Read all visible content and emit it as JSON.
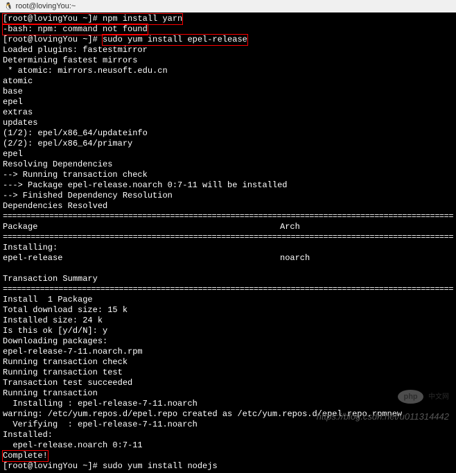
{
  "titlebar": {
    "title": "root@lovingYou:~"
  },
  "terminal": {
    "prompt1": "[root@lovingYou ~]# ",
    "cmd1": "npm install yarn",
    "error1": "-bash: npm: command not found",
    "prompt2": "[root@lovingYou ~]# ",
    "cmd2": "sudo yum install epel-release",
    "lines": [
      "Loaded plugins: fastestmirror",
      "Determining fastest mirrors",
      " * atomic: mirrors.neusoft.edu.cn",
      "atomic",
      "base",
      "epel",
      "extras",
      "updates",
      "(1/2): epel/x86_64/updateinfo",
      "(2/2): epel/x86_64/primary",
      "epel",
      "Resolving Dependencies",
      "--> Running transaction check",
      "---> Package epel-release.noarch 0:7-11 will be installed",
      "--> Finished Dependency Resolution",
      "",
      "Dependencies Resolved",
      ""
    ],
    "separator": "============================================================================================================",
    "table": {
      "header_package": " Package",
      "header_arch": "Arch",
      "installing_label": "Installing:",
      "pkg_name": " epel-release",
      "pkg_arch": "noarch"
    },
    "summary_label": "Transaction Summary",
    "dashline": "------------------------------------------------------------------------------------------------------------",
    "install_count": "Install  1 Package",
    "details": [
      "",
      "Total download size: 15 k",
      "Installed size: 24 k",
      "Is this ok [y/d/N]: y",
      "Downloading packages:",
      "epel-release-7-11.noarch.rpm",
      "Running transaction check",
      "Running transaction test",
      "Transaction test succeeded",
      "Running transaction",
      "  Installing : epel-release-7-11.noarch",
      "warning: /etc/yum.repos.d/epel.repo created as /etc/yum.repos.d/epel.repo.rpmnew",
      "  Verifying  : epel-release-7-11.noarch",
      "",
      "Installed:",
      "  epel-release.noarch 0:7-11",
      ""
    ],
    "complete": "Complete!",
    "prompt3": "[root@lovingYou ~]# sudo yum install nodejs"
  },
  "watermark": {
    "php": "php",
    "text": "中文网"
  },
  "footer": {
    "url": "https://blog.csdn.net/u011314442"
  }
}
